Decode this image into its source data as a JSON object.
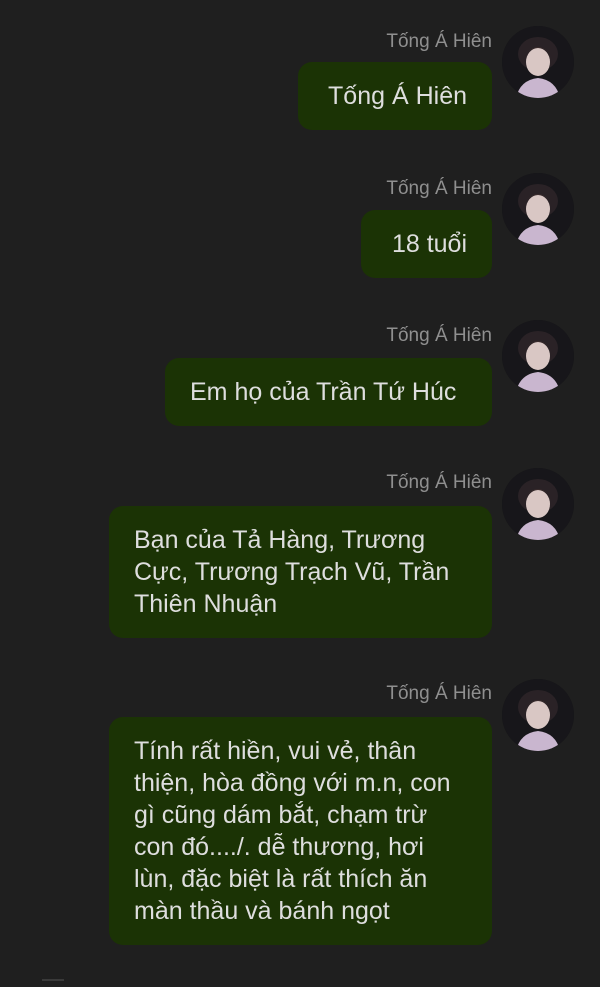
{
  "chat": {
    "messages": [
      {
        "sender": "Tống Á Hiên",
        "text": "Tống Á Hiên"
      },
      {
        "sender": "Tống Á Hiên",
        "text": "18 tuổi"
      },
      {
        "sender": "Tống Á Hiên",
        "text": "Em họ của Trần Tứ Húc"
      },
      {
        "sender": "Tống Á Hiên",
        "text": "Bạn của Tả Hàng, Trương Cực, Trương Trạch Vũ, Trần Thiên Nhuận"
      },
      {
        "sender": "Tống Á Hiên",
        "text": "Tính rất hiền, vui vẻ, thân thiện, hòa đồng với m.n, con gì cũng dám bắt, chạm trừ con đó..../. dễ thương, hơi lùn, đặc biệt là rất thích ăn màn thầu và bánh ngọt"
      }
    ]
  },
  "colors": {
    "background": "#1f1f1f",
    "bubble": "#1b3305",
    "bubble_text": "#dedede",
    "sender_text": "#8f8f8f"
  },
  "icons": {
    "avatar": "avatar-photo"
  }
}
